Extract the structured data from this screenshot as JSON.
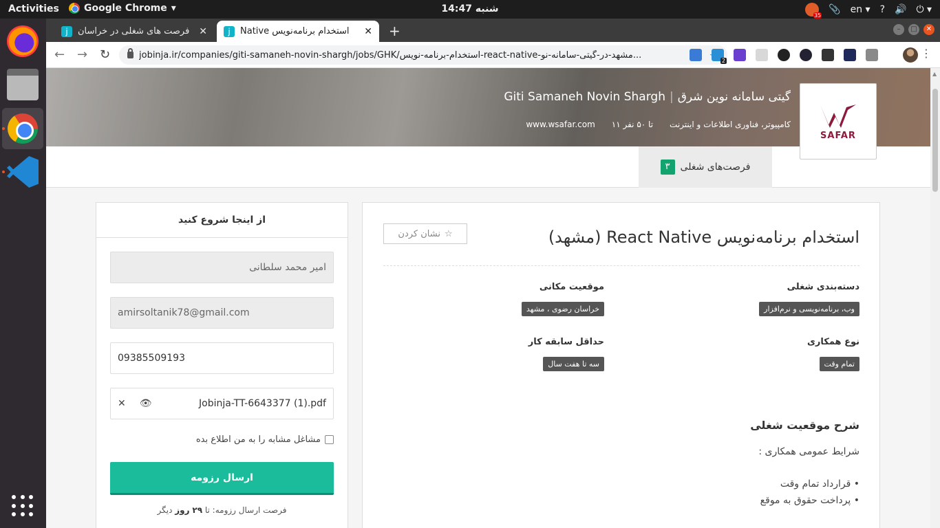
{
  "system": {
    "activities": "Activities",
    "app_name": "Google Chrome",
    "clock": "شنبه 14:47",
    "lang": "en",
    "tray_badge": "35"
  },
  "browser": {
    "tabs": [
      {
        "title": "فرصت های شغلی در خراسان",
        "favicon": "j"
      },
      {
        "title": "استخدام برنامه‌نویس Native",
        "favicon": "j"
      }
    ],
    "url": "jobinja.ir/companies/giti-samaneh-novin-shargh/jobs/GHK/استخدام-برنامه-نویس-react-native-مشهد-در-گیتی-سامانه-نو...",
    "extension_badge": "2"
  },
  "company": {
    "name_fa": "گیتی سامانه نوین شرق",
    "name_en": "Giti Samaneh Novin Shargh",
    "industry": "کامپیوتر، فناوری اطلاعات و اینترنت",
    "size": "۱۱ تا ۵۰ نفر",
    "website": "www.wsafar.com",
    "logo_text": "SAFAR",
    "jobs_tab_label": "فرصت‌های شغلی",
    "jobs_count": "۳"
  },
  "job": {
    "title": "استخدام برنامه‌نویس React Native (مشهد)",
    "bookmark_label": "نشان کردن",
    "category_label": "دسته‌بندی شغلی",
    "category_value": "وب، برنامه‌نویسی و نرم‌افزار",
    "location_label": "موقعیت مکانی",
    "location_value": "خراسان رضوی ، مشهد",
    "type_label": "نوع همکاری",
    "type_value": "تمام وقت",
    "experience_label": "حداقل سابقه کار",
    "experience_value": "سه تا هفت سال",
    "description_title": "شرح موقعیت شغلی",
    "description_intro": "شرایط عمومی همکاری :",
    "bullets": [
      "قرارداد تمام وقت",
      "پرداخت حقوق به موقع"
    ]
  },
  "apply": {
    "header": "از اینجا شروع کنید",
    "name_value": "امیر محمد سلطانی",
    "email_value": "amirsoltanik78@gmail.com",
    "phone_value": "09385509193",
    "file_name": "Jobinja-TT-6643377 (1).pdf",
    "checkbox_label": "مشاغل مشابه را به من اطلاع بده",
    "submit_label": "ارسال رزومه",
    "deadline_prefix": "فرصت ارسال رزومه: تا",
    "deadline_days": "۲۹",
    "deadline_unit": "روز",
    "deadline_suffix": "دیگر"
  }
}
